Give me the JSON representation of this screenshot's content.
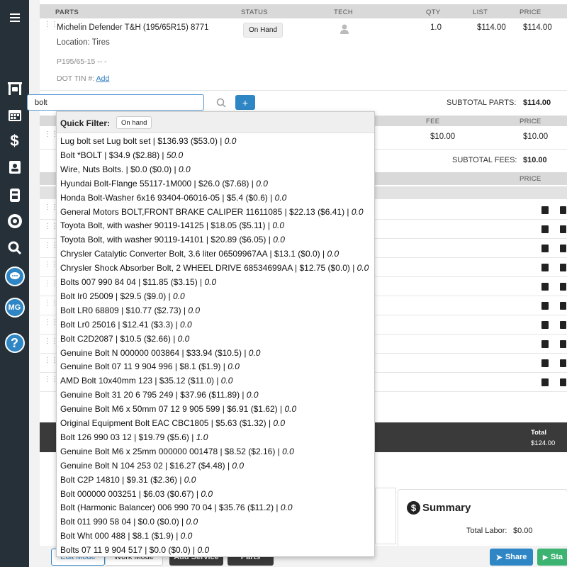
{
  "header_parts": {
    "parts": "PARTS",
    "status": "STATUS",
    "tech": "TECH",
    "qty": "QTY",
    "list": "LIST",
    "price": "PRICE"
  },
  "part": {
    "name": "Michelin Defender T&H (195/65R15) 8771",
    "location": "Location: Tires",
    "spec": "P195/65-15 -- -",
    "dot_label": "DOT TIN #:",
    "dot_link": "Add",
    "status": "On Hand",
    "qty": "1.0",
    "list": "$114.00",
    "price": "$114.00"
  },
  "search": {
    "value": "bolt",
    "add_label": "+"
  },
  "subtotal_parts": {
    "label": "SUBTOTAL PARTS:",
    "value": "$114.00"
  },
  "fees_header": {
    "fee": "FEE",
    "price": "PRICE"
  },
  "fee_row": {
    "fee": "$10.00",
    "price": "$10.00"
  },
  "subtotal_fees": {
    "label": "SUBTOTAL FEES:",
    "value": "$10.00"
  },
  "labor_header": {
    "price": "PRICE"
  },
  "total": {
    "label": "Total",
    "value": "$124.00"
  },
  "summary": {
    "title": "Summary",
    "total_labor_label": "Total Labor:",
    "total_labor_value": "$0.00"
  },
  "bottom": {
    "edit_mode": "Edit Mode",
    "work_mode": "Work Mode",
    "add_service": "Add Service",
    "parts": "Parts",
    "share": "Share",
    "start": "Sta"
  },
  "rail": {
    "initials": "MG"
  },
  "dropdown": {
    "quick_filter_label": "Quick Filter:",
    "chip": "On hand",
    "options": [
      {
        "text": "Lug bolt set Lug bolt set | $136.93 ($53.0) | ",
        "qty": "0.0"
      },
      {
        "text": "Bolt *BOLT | $34.9 ($2.88) | ",
        "qty": "50.0"
      },
      {
        "text": "Wire, Nuts Bolts. | $0.0 ($0.0) | ",
        "qty": "0.0"
      },
      {
        "text": "Hyundai Bolt-Flange 55117-1M000 | $26.0 ($7.68) | ",
        "qty": "0.0"
      },
      {
        "text": "Honda Bolt-Washer 6x16 93404-06016-05 | $5.4 ($0.6) | ",
        "qty": "0.0"
      },
      {
        "text": "General Motors BOLT,FRONT BRAKE CALIPER 11611085 | $22.13 ($6.41) | ",
        "qty": "0.0"
      },
      {
        "text": "Toyota Bolt, with washer 90119-14125 | $18.05 ($5.11) | ",
        "qty": "0.0"
      },
      {
        "text": "Toyota Bolt, with washer 90119-14101 | $20.89 ($6.05) | ",
        "qty": "0.0"
      },
      {
        "text": "Chrysler Catalytic Converter Bolt, 3.6 liter 06509967AA | $13.1 ($0.0) | ",
        "qty": "0.0"
      },
      {
        "text": "Chrysler Shock Absorber Bolt, 2 WHEEL DRIVE 68534699AA | $12.75 ($0.0) | ",
        "qty": "0.0"
      },
      {
        "text": "Bolts 007 990 84 04 | $11.85 ($3.15) | ",
        "qty": "0.0"
      },
      {
        "text": "Bolt Ir0 25009 | $29.5 ($9.0) | ",
        "qty": "0.0"
      },
      {
        "text": "Bolt LR0 68809 | $10.77 ($2.73) | ",
        "qty": "0.0"
      },
      {
        "text": "Bolt Lr0 25016 | $12.41 ($3.3) | ",
        "qty": "0.0"
      },
      {
        "text": "Bolt C2D2087 | $10.5 ($2.66) | ",
        "qty": "0.0"
      },
      {
        "text": "Genuine Bolt N 000000 003864 | $33.94 ($10.5) | ",
        "qty": "0.0"
      },
      {
        "text": "Genuine Bolt 07 11 9 904 996 | $8.1 ($1.9) | ",
        "qty": "0.0"
      },
      {
        "text": "AMD Bolt 10x40mm 123 | $35.12 ($11.0) | ",
        "qty": "0.0"
      },
      {
        "text": "Genuine Bolt 31 20 6 795 249 | $37.96 ($11.89) | ",
        "qty": "0.0"
      },
      {
        "text": "Genuine Bolt M6 x 50mm 07 12 9 905 599 | $6.91 ($1.62) | ",
        "qty": "0.0"
      },
      {
        "text": "Original Equipment Bolt EAC CBC1805 | $5.63 ($1.32) | ",
        "qty": "0.0"
      },
      {
        "text": "Bolt 126 990 03 12 | $19.79 ($5.6) | ",
        "qty": "1.0"
      },
      {
        "text": "Genuine Bolt M6 x 25mm 000000 001478 | $8.52 ($2.16) | ",
        "qty": "0.0"
      },
      {
        "text": "Genuine Bolt N 104 253 02 | $16.27 ($4.48) | ",
        "qty": "0.0"
      },
      {
        "text": "Bolt C2P 14810 | $9.31 ($2.36) | ",
        "qty": "0.0"
      },
      {
        "text": "Bolt 000000 003251 | $6.03 ($0.67) | ",
        "qty": "0.0"
      },
      {
        "text": "Bolt (Harmonic Balancer) 006 990 70 04 | $35.76 ($11.2) | ",
        "qty": "0.0"
      },
      {
        "text": "Bolt 011 990 58 04 | $0.0 ($0.0) | ",
        "qty": "0.0"
      },
      {
        "text": "Bolt Wht 000 488 | $8.1 ($1.9) | ",
        "qty": "0.0"
      },
      {
        "text": "Bolts 07 11 9 904 517 | $0.0 ($0.0) | ",
        "qty": "0.0"
      }
    ]
  }
}
